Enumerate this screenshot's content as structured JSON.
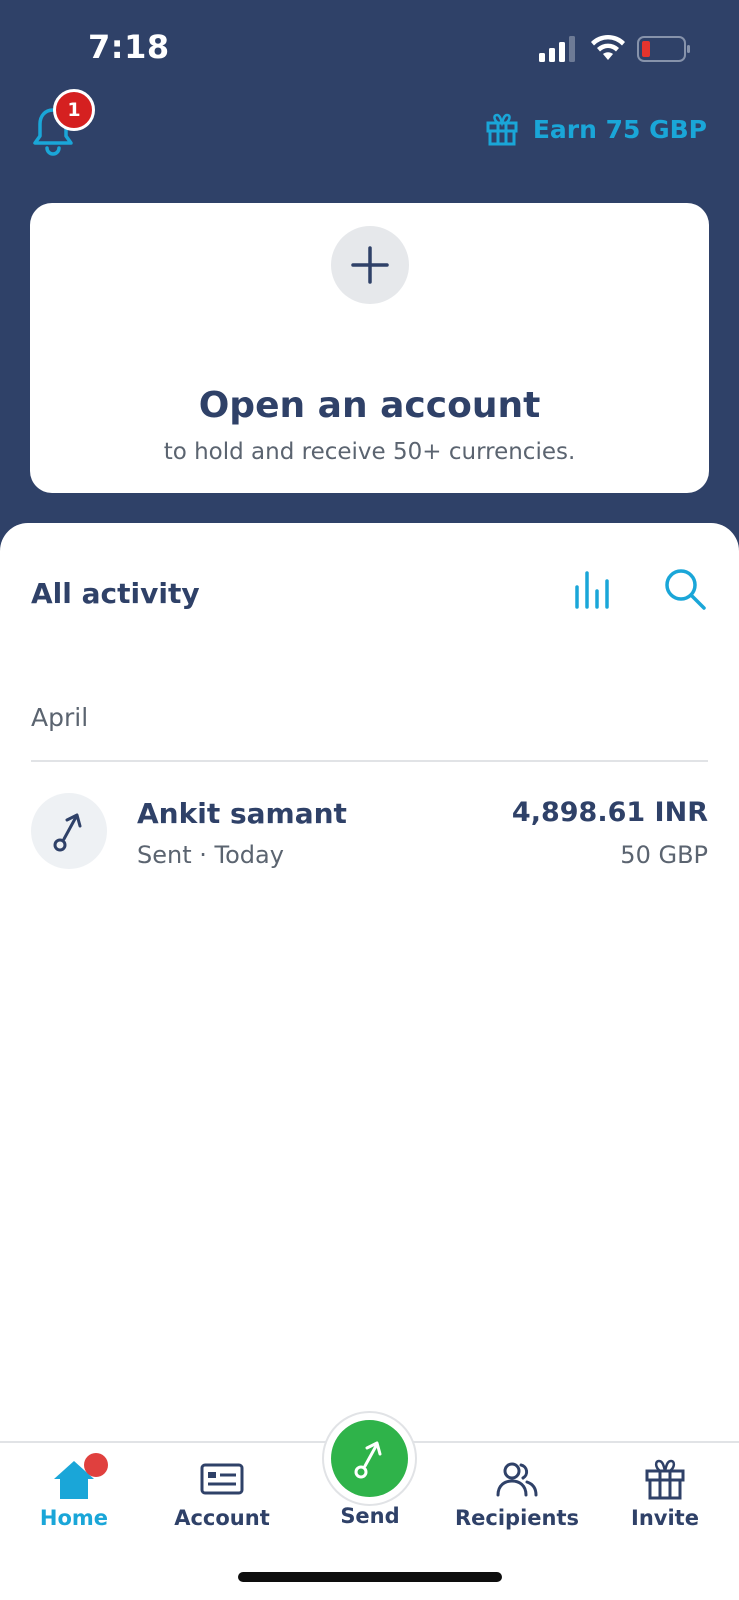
{
  "status_bar": {
    "time": "7:18"
  },
  "header": {
    "notification_count": "1",
    "earn_label": "Earn 75 GBP"
  },
  "card": {
    "title": "Open an account",
    "subtitle": "to hold and receive 50+ currencies."
  },
  "activity": {
    "title": "All activity",
    "month": "April",
    "transactions": [
      {
        "name": "Ankit samant",
        "meta": "Sent · Today",
        "amount": "4,898.61 INR",
        "sub_amount": "50 GBP"
      }
    ]
  },
  "nav": {
    "items": [
      {
        "label": "Home",
        "icon": "home-icon",
        "active": true
      },
      {
        "label": "Account",
        "icon": "account-card-icon"
      },
      {
        "label": "Send",
        "icon": "send-arrow-icon"
      },
      {
        "label": "Recipients",
        "icon": "recipients-icon"
      },
      {
        "label": "Invite",
        "icon": "gift-icon"
      }
    ]
  },
  "colors": {
    "header_bg": "#2f4168",
    "accent": "#1aa6d8",
    "send_green": "#2fb34a",
    "badge_red": "#d52020"
  }
}
